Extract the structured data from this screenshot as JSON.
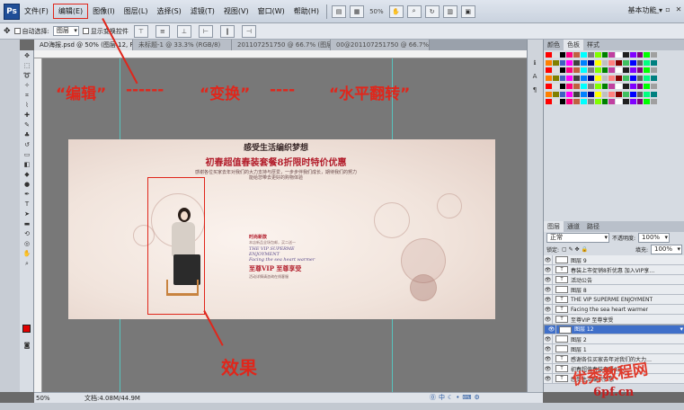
{
  "menubar": {
    "logo": "Ps",
    "items": [
      "文件(F)",
      "编辑(E)",
      "图像(I)",
      "图层(L)",
      "选择(S)",
      "滤镜(T)",
      "视图(V)",
      "窗口(W)",
      "帮助(H)"
    ],
    "zoom": "50%",
    "workspace": "基本功能 ▾",
    "win_min": "_",
    "win_restore": "▫",
    "win_close": "✕"
  },
  "options": {
    "auto_select_label": "自动选择:",
    "auto_select_value": "图层",
    "show_transform_label": "显示变换控件"
  },
  "tabs": [
    "AD海报.psd @ 50% (图层 12, RGB/8*)",
    "未标题-1 @ 33.3% (RGB/8)",
    "201107251750 @ 66.7% (图层 1, RGB/8)",
    "00@201107251750 @ 66.7% (图层 1, RGB/8)"
  ],
  "banner": {
    "title": "感受生活编织梦想",
    "subtitle": "初春超值春装套餐8折限时特价优惠",
    "desc": "感谢各位买家去年对我们的大力支持与厚爱，一步步伴我们成长，期待我们的努力能给您带去更好的购物体验",
    "promo_cn": "时尚新款",
    "promo_small": "本店新品全场包邮，买二送一",
    "promo_en1": "THE VIP SUPERME ENJOYMENT",
    "promo_en2": "Facing the sea heart warmer",
    "promo_vip": "至尊VIP 至尊享受",
    "promo_note": "活动详情请咨询在线客服"
  },
  "annotations": {
    "edit": "“编辑”",
    "dash1": "------",
    "transform": "“变换”",
    "dash2": "----",
    "flip": "“水平翻转”",
    "result": "效果"
  },
  "rightpanel": {
    "swatch_tabs": [
      "颜色",
      "色板",
      "样式"
    ],
    "layer_tabs": [
      "图层",
      "通道",
      "路径"
    ],
    "blend_mode": "正常",
    "opacity_label": "不透明度:",
    "opacity": "100%",
    "lock_label": "锁定:",
    "fill_label": "填充:",
    "fill": "100%",
    "layers": [
      {
        "name": "图层 9",
        "thumb": "",
        "selected": false
      },
      {
        "name": "春装上市促销8折优惠 加入VIP享…",
        "thumb": "T",
        "selected": false
      },
      {
        "name": "活动公告",
        "thumb": "T",
        "selected": false
      },
      {
        "name": "图层 8",
        "thumb": "",
        "selected": false
      },
      {
        "name": "THE VIP SUPERME ENJOYMENT",
        "thumb": "T",
        "selected": false
      },
      {
        "name": "Facing the sea heart warmer",
        "thumb": "T",
        "selected": false
      },
      {
        "name": "至尊VIP 至尊享受",
        "thumb": "T",
        "selected": false
      },
      {
        "name": "图层 12",
        "thumb": "",
        "selected": true
      },
      {
        "name": "图层 2",
        "thumb": "",
        "selected": false
      },
      {
        "name": "图层 1",
        "thumb": "",
        "selected": false
      },
      {
        "name": "感谢各位买家去年对我们的大力…",
        "thumb": "T",
        "selected": false
      },
      {
        "name": "初春超值春装套餐8折…",
        "thumb": "T",
        "selected": false
      },
      {
        "name": "感受生活编织梦想",
        "thumb": "T",
        "selected": false
      }
    ]
  },
  "status": {
    "zoom": "50%",
    "doc": "文档:4.08M/44.9M"
  },
  "watermark": {
    "line1": "优秀教程网",
    "line2": "6pf.cn"
  },
  "colors": {
    "accent_red": "#e0261b",
    "guide": "#4fd6d0",
    "selected_layer": "#3f6fc9"
  }
}
